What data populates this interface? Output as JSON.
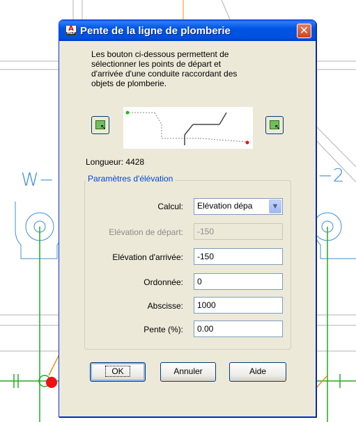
{
  "dialog": {
    "title": "Pente de la ligne de plomberie",
    "icon_label": "A",
    "icon_sub": "MEP",
    "description": "Les bouton ci-dessous permettent de\nsélectionner les points de départ et\nd'arrivée d'une conduite raccordant des\nobjets de plomberie.",
    "length_label": "Longueur:",
    "length_value": "4428",
    "group_title": "Paramètres d'élévation",
    "fields": {
      "calcul": {
        "label": "Calcul:",
        "value": "Elévation dépa"
      },
      "start_elevation": {
        "label": "Elévation de départ:",
        "value": "-150",
        "enabled": false
      },
      "end_elevation": {
        "label": "Elévation d'arrivée:",
        "value": "-150"
      },
      "ordinate": {
        "label": "Ordonnée:",
        "value": "0"
      },
      "abscissa": {
        "label": "Abscisse:",
        "value": "1000"
      },
      "slope": {
        "label": "Pente (%):",
        "value": "0.00"
      }
    },
    "buttons": {
      "ok": "OK",
      "cancel": "Annuler",
      "help": "Aide"
    }
  },
  "background": {
    "left_label": "W−",
    "right_label": "−2"
  },
  "icons": {
    "close": "close-icon",
    "pick_start": "pick-point-icon",
    "pick_end": "pick-point-icon",
    "dropdown": "chevron-down-icon"
  },
  "colors": {
    "titlebar": "#0054e3",
    "dialog_bg": "#ece9d8",
    "cad_lines": "#3c8fd6",
    "cad_pipe": "#22aa22",
    "cad_orange": "#e8901a",
    "cad_red": "#ee1111"
  }
}
